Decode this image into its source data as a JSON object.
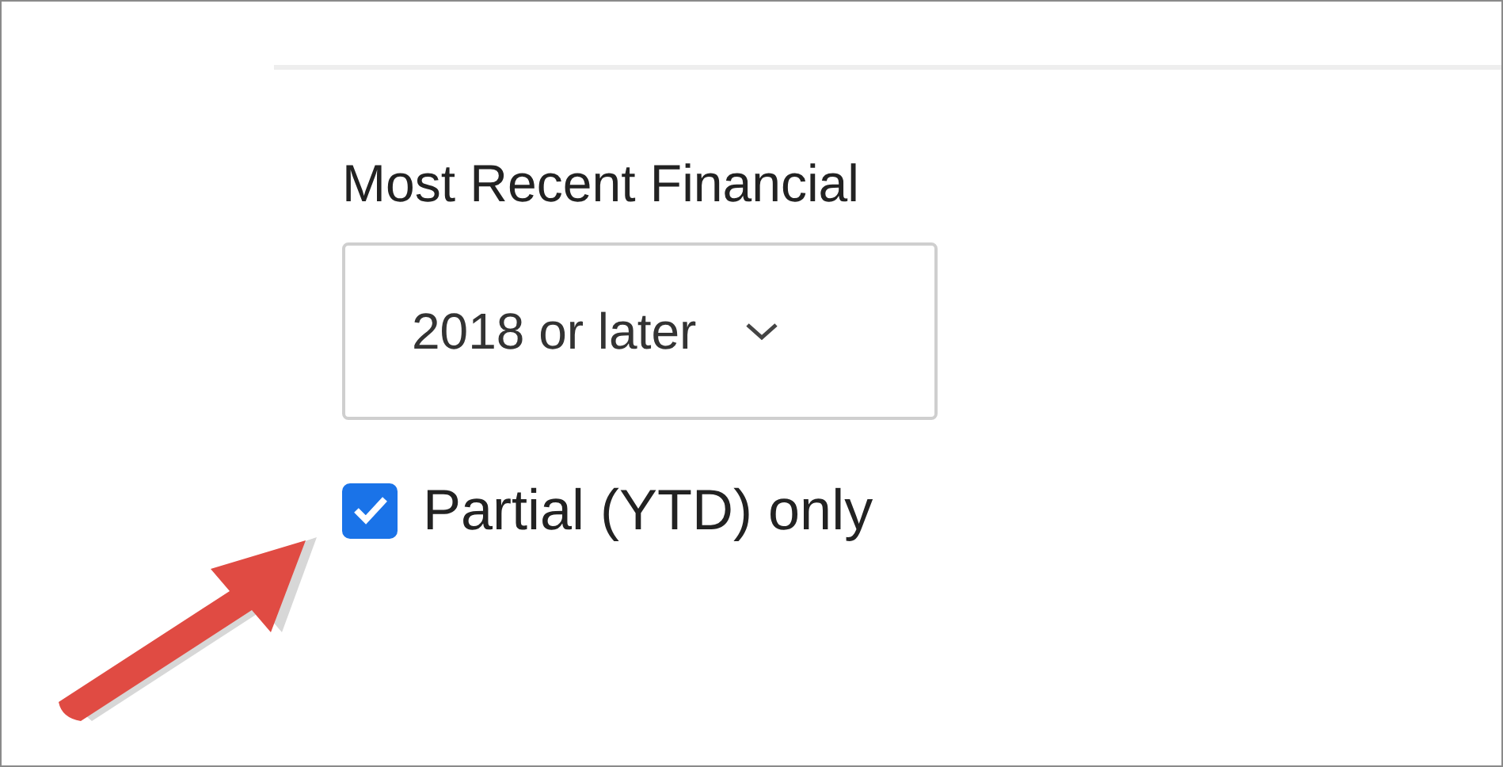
{
  "filter": {
    "label": "Most Recent Financial",
    "select": {
      "value": "2018 or later"
    },
    "checkbox": {
      "label": "Partial (YTD) only",
      "checked": true
    }
  }
}
